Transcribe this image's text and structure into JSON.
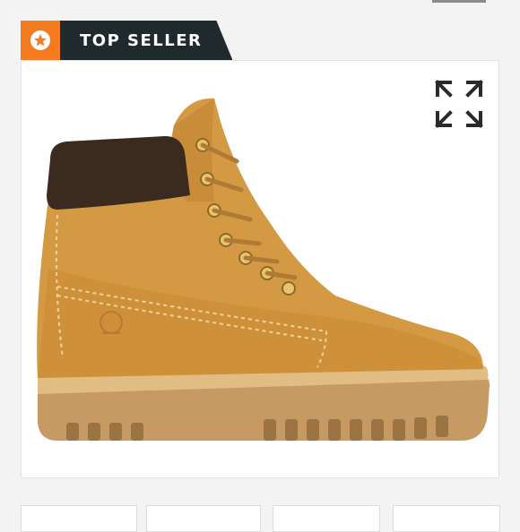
{
  "badge": {
    "label": "TOP SELLER",
    "icon": "star-icon",
    "accent": "#f47b20",
    "dark": "#1f2a2c"
  },
  "image_panel": {
    "icon": "expand-icon"
  },
  "thumbnails": [
    "",
    "",
    "",
    ""
  ]
}
